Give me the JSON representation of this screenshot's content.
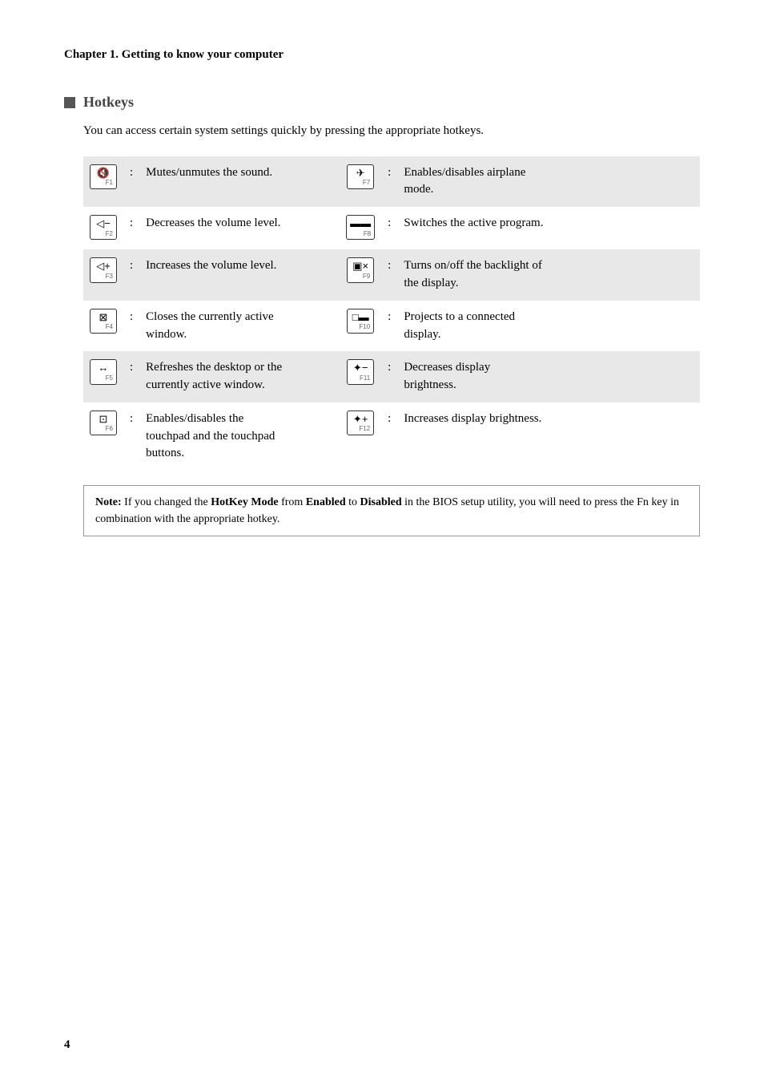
{
  "chapter": {
    "title": "Chapter 1. Getting to know your computer"
  },
  "section": {
    "title": "Hotkeys",
    "intro": "You can access certain system settings quickly by pressing the appropriate hotkeys."
  },
  "hotkeys": [
    {
      "left": {
        "key_main": "🔇",
        "key_sub": "F1",
        "description": "Mutes/unmutes the sound."
      },
      "right": {
        "key_main": "✈",
        "key_sub": "F7",
        "description": "Enables/disables airplane mode."
      }
    },
    {
      "left": {
        "key_main": "◁−",
        "key_sub": "F2",
        "description": "Decreases the volume level."
      },
      "right": {
        "key_main": "▬▬▬",
        "key_sub": "F8",
        "description": "Switches the active program."
      }
    },
    {
      "left": {
        "key_main": "◁+",
        "key_sub": "F3",
        "description": "Increases the volume level."
      },
      "right": {
        "key_main": "▣×",
        "key_sub": "F9",
        "description": "Turns on/off the backlight of the display."
      }
    },
    {
      "left": {
        "key_main": "⊠",
        "key_sub": "F4",
        "description": "Closes the currently active window."
      },
      "right": {
        "key_main": "□▬",
        "key_sub": "F10",
        "description": "Projects to a connected display."
      }
    },
    {
      "left": {
        "key_main": "↔",
        "key_sub": "F5",
        "description": "Refreshes the desktop or the currently active window."
      },
      "right": {
        "key_main": "✳−",
        "key_sub": "F11",
        "description": "Decreases display brightness."
      }
    },
    {
      "left": {
        "key_main": "⊡",
        "key_sub": "F6",
        "description": "Enables/disables the touchpad and the touchpad buttons."
      },
      "right": {
        "key_main": "✳+",
        "key_sub": "F12",
        "description": "Increases display brightness."
      }
    }
  ],
  "note": {
    "label": "Note:",
    "text": "If you changed the ",
    "highlight1": "HotKey Mode",
    "text2": " from ",
    "highlight2": "Enabled",
    "text3": " to ",
    "highlight3": "Disabled",
    "text4": " in the BIOS setup utility, you will need to press the Fn key in combination with the appropriate hotkey."
  },
  "page_number": "4"
}
